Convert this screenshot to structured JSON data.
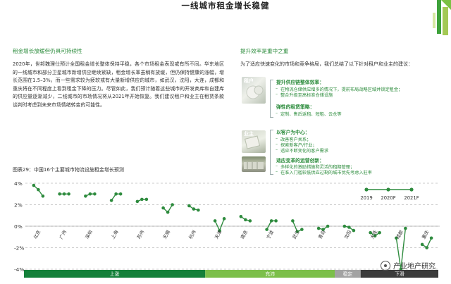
{
  "page": {
    "title": "一线城市租金增长稳健"
  },
  "left": {
    "heading": "租金增长放缓但仍具可持续性",
    "body": "2020年，世邦魏理仕预计全国租金增长整体保持平稳，各个市场租金表现或有所不同。华东地区的一线城市和部分卫星城市新增供应继续紧缺，租金增长率虽稍有放缓，但仍保持健康的涨幅，增长范围在1.5–3%。而一些需求较为疲软或有大量新增供应的城市，如武汉，沈阳，大连，成都和重庆将在不同程度上看到租金下降的压力。尽管如此，我们预计随着这些城市的开发商库和自建库的供应量逐渐减少，二线城市的市场情况将从2021年开始恢复。我们建议租户和业主在租赁条款谈判时考虑到未来市场情绪转变的可能性。"
  },
  "right": {
    "heading": "提升效率是重中之重",
    "intro": "为了适应快速变化的市场和竞争格局，我们总结了以下针对租户和业主的建议：",
    "photo_labels": {
      "tenant": "租户",
      "landlord": "业主"
    },
    "tenant_groups": [
      {
        "title": "提升供应链整体效率：",
        "items": [
          "在物流仓储供应增多的情况下，提前布局战略区域并锁定租金；",
          "整合升级至高标准仓储设施"
        ]
      },
      {
        "title": "弹性的租赁策略：",
        "items": [
          "定制、售后返租、短租、云仓等"
        ]
      }
    ],
    "landlord_groups": [
      {
        "title": "以客户为中心：",
        "items": [
          "改善客户关系；",
          "探索新客户/行业；",
          "适应不断变化的客户需求"
        ]
      },
      {
        "title": "适应变革的运营创新：",
        "items": [
          "多样化的激励措施和灵活的租期管理；",
          "在准入门槛较低供应过剩的城市优先考虑入驻率"
        ]
      }
    ]
  },
  "watermark": {
    "text": "产业地产研究"
  },
  "colors": {
    "accent_green": "#2c8c3c",
    "line": "#2e8b3e",
    "band_rise": "#14803a",
    "band_stable": "#7cbf4a",
    "band_steady": "#a3a3a3",
    "band_fall": "#3b3b3b"
  },
  "chart_data": {
    "type": "line",
    "title": "图表29：中国16个主要城市物流设施租金增长预测",
    "years": [
      "2019",
      "2020F",
      "2021F"
    ],
    "ylim": [
      -4,
      4
    ],
    "yticks": [
      "4%",
      "2%",
      "0%",
      "-2%",
      "-4%"
    ],
    "yticks_values": [
      4,
      2,
      0,
      -2,
      -4
    ],
    "grid": "dashed-horizontal",
    "cities": [
      {
        "name": "北京",
        "values": [
          3.8,
          3.4,
          2.8
        ]
      },
      {
        "name": "广州",
        "values": [
          3.0,
          3.0,
          3.0
        ]
      },
      {
        "name": "深圳",
        "values": [
          2.8,
          3.0,
          3.0
        ]
      },
      {
        "name": "上海",
        "values": [
          2.4,
          3.0,
          3.0
        ]
      },
      {
        "name": "苏州",
        "values": [
          2.3,
          2.5,
          2.5
        ]
      },
      {
        "name": "无锡",
        "values": [
          1.7,
          1.3,
          2.0
        ]
      },
      {
        "name": "杭州",
        "values": [
          1.9,
          1.6,
          1.5
        ]
      },
      {
        "name": "天津",
        "values": [
          0.5,
          -0.4,
          0.7
        ]
      },
      {
        "name": "南京",
        "values": [
          0.9,
          0.6,
          0.5
        ]
      },
      {
        "name": "宁波",
        "values": [
          -0.3,
          0.5,
          0.5
        ]
      },
      {
        "name": "武汉",
        "values": [
          0.5,
          -0.5,
          -0.3
        ]
      },
      {
        "name": "青岛",
        "values": [
          -0.2,
          -0.3,
          0.0
        ]
      },
      {
        "name": "沈阳",
        "values": [
          0.0,
          -0.1,
          -0.4
        ]
      },
      {
        "name": "大连",
        "values": [
          -0.6,
          -0.9,
          -0.6
        ]
      },
      {
        "name": "成都",
        "values": [
          -1.1,
          -4.0,
          -0.2
        ]
      },
      {
        "name": "重庆",
        "values": [
          -1.7,
          -2.0,
          -1.1
        ]
      }
    ],
    "bands": [
      {
        "label": "上涨",
        "from": 0,
        "to": 7,
        "color": "#14803a"
      },
      {
        "label": "充沛",
        "from": 7,
        "to": 12,
        "color": "#7cbf4a"
      },
      {
        "label": "稳定",
        "from": 12,
        "to": 13,
        "color": "#a3a3a3"
      },
      {
        "label": "下滑",
        "from": 13,
        "to": 16,
        "color": "#3b3b3b"
      }
    ],
    "legend_position": "top-right"
  }
}
